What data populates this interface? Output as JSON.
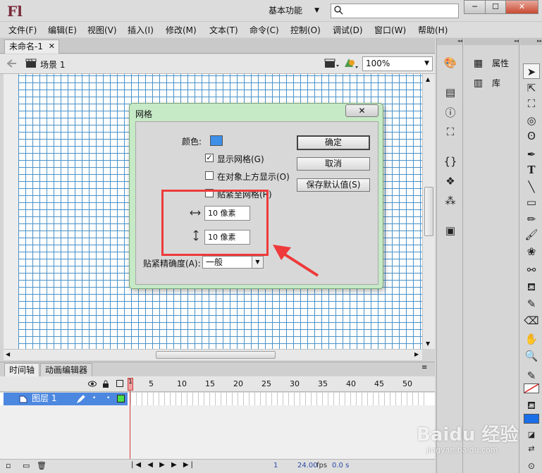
{
  "app": {
    "logo": "Fl",
    "workspace": "基本功能"
  },
  "window_controls": {
    "minimize": "─",
    "maximize": "☐",
    "close": "✕"
  },
  "menu": [
    "文件(F)",
    "编辑(E)",
    "视图(V)",
    "插入(I)",
    "修改(M)",
    "文本(T)",
    "命令(C)",
    "控制(O)",
    "调试(D)",
    "窗口(W)",
    "帮助(H)"
  ],
  "document": {
    "tab": "未命名-1",
    "scene": "场景 1",
    "zoom": "100%"
  },
  "dialog": {
    "title": "网格",
    "color_label": "颜色:",
    "grid_color": "#3d8fe8",
    "show_grid": "显示网格(G)",
    "show_grid_checked": true,
    "show_over_objects": "在对象上方显示(O)",
    "show_over_objects_checked": false,
    "snap_to_grid": "贴紧至网格(R)",
    "snap_to_grid_checked": false,
    "h_spacing": "10 像素",
    "v_spacing": "10 像素",
    "snap_accuracy_label": "贴紧精确度(A):",
    "snap_accuracy_value": "一般",
    "ok": "确定",
    "cancel": "取消",
    "save_default": "保存默认值(S)"
  },
  "timeline": {
    "tabs": [
      "时间轴",
      "动画编辑器"
    ],
    "frame_numbers": [
      "1",
      "5",
      "10",
      "15",
      "20",
      "25",
      "30",
      "35",
      "40",
      "45",
      "50"
    ],
    "layer_name": "图层 1",
    "current_frame": "1",
    "fps": "24.00",
    "fps_unit": "fps",
    "time": "0.0 s"
  },
  "right_panel": {
    "properties": "属性",
    "library": "库"
  },
  "watermark": {
    "brand": "Baidu 经验",
    "url": "jingyan.baidu.com"
  }
}
